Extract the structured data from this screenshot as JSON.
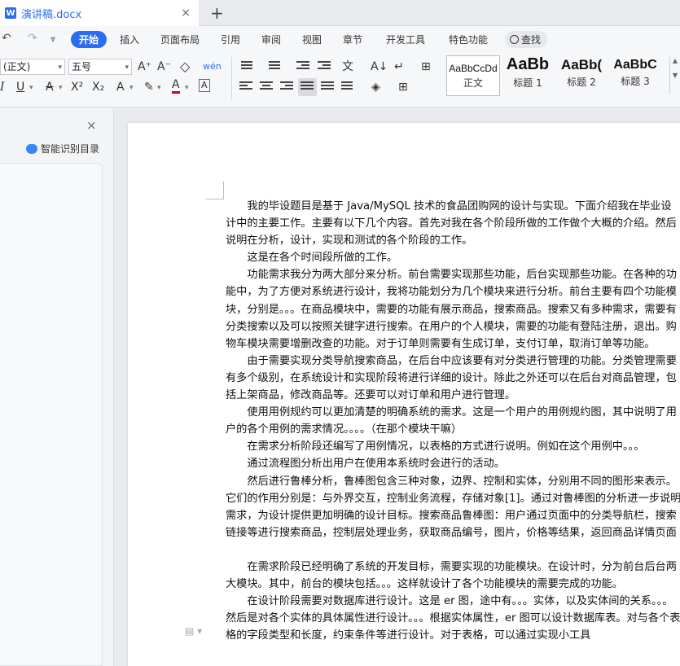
{
  "tab": {
    "title": "演讲稿.docx",
    "close": "×",
    "new": "+"
  },
  "menu": {
    "undo": "↶",
    "redo": "↷",
    "more": "⩔",
    "active": "开始",
    "items": [
      "插入",
      "页面布局",
      "引用",
      "审阅",
      "视图",
      "章节",
      "开发工具",
      "特色功能"
    ],
    "search": "查找"
  },
  "toolbar": {
    "style_value": "(正文)",
    "size_value": "五号",
    "grow": "A⁺",
    "shrink": "A⁻",
    "clear": "◇",
    "phonetic": "wén",
    "italic": "I",
    "underline": "U",
    "strike": "A",
    "superscript": "X²",
    "subscript": "X₂",
    "effects": "A",
    "highlight": "✎",
    "color": "A",
    "charborder": "A",
    "styles": [
      {
        "sample": "AaBbCcDd",
        "label": "正文"
      },
      {
        "sample": "AaBb",
        "label": "标题 1"
      },
      {
        "sample": "AaBb(",
        "label": "标题 2"
      },
      {
        "sample": "AaBbC",
        "label": "标题 3"
      }
    ]
  },
  "leftpane": {
    "close": "×",
    "smart_toc": "智能识别目录"
  },
  "document": {
    "paragraphs": [
      "我的毕设题目是基于 Java/MySQL 技术的食品团购网的设计与实现。下面介绍我在毕业设计中的主要工作。主要有以下几个内容。首先对我在各个阶段所做的工作做个大概的介绍。然后说明在分析，设计，实现和测试的各个阶段的工作。",
      "这是在各个时间段所做的工作。",
      "功能需求我分为两大部分来分析。前台需要实现那些功能，后台实现那些功能。在各种的功能中，为了方便对系统进行设计，我将功能划分为几个模块来进行分析。前台主要有四个功能模块，分别是。。。在商品模块中，需要的功能有展示商品，搜索商品。搜索又有多种需求，需要有分类搜索以及可以按照关键字进行搜索。在用户的个人模块，需要的功能有登陆注册，退出。购物车模块需要增删改查的功能。对于订单则需要有生成订单，支付订单，取消订单等功能。",
      "由于需要实现分类导航搜索商品，在后台中应该要有对分类进行管理的功能。分类管理需要有多个级别，在系统设计和实现阶段将进行详细的设计。除此之外还可以在后台对商品管理，包括上架商品，修改商品等。还要可以对订单和用户进行管理。",
      "使用用例规约可以更加清楚的明确系统的需求。这是一个用户的用例规约图，其中说明了用户的各个用例的需求情况。。。。（在那个模块干嘛）",
      "在需求分析阶段还编写了用例情况，以表格的方式进行说明。例如在这个用例中。。。",
      "通过流程图分析出用户在使用本系统时会进行的活动。",
      "然后进行鲁棒分析，鲁棒图包含三种对象，边界、控制和实体，分别用不同的图形来表示。它们的作用分别是：与外界交互，控制业务流程，存储对象[1]。通过对鲁棒图的分析进一步说明需求，为设计提供更加明确的设计目标。搜索商品鲁棒图：用户通过页面中的分类导航栏，搜索链接等进行搜索商品，控制层处理业务，获取商品编号，图片，价格等结果，返回商品详情页面",
      "",
      "在需求阶段已经明确了系统的开发目标，需要实现的功能模块。在设计时，分为前台后台两大模块。其中，前台的模块包括。。。这样就设计了各个功能模块的需要完成的功能。",
      "在设计阶段需要对数据库进行设计。这是 er 图，途中有。。。实体，以及实体间的关系。。。然后是对各个实体的具体属性进行设计。。。根据实体属性，er 图可以设计数据库表。对与各个表格的字段类型和长度，约束条件等进行设计。对于表格，可以通过实现小工具"
    ]
  }
}
